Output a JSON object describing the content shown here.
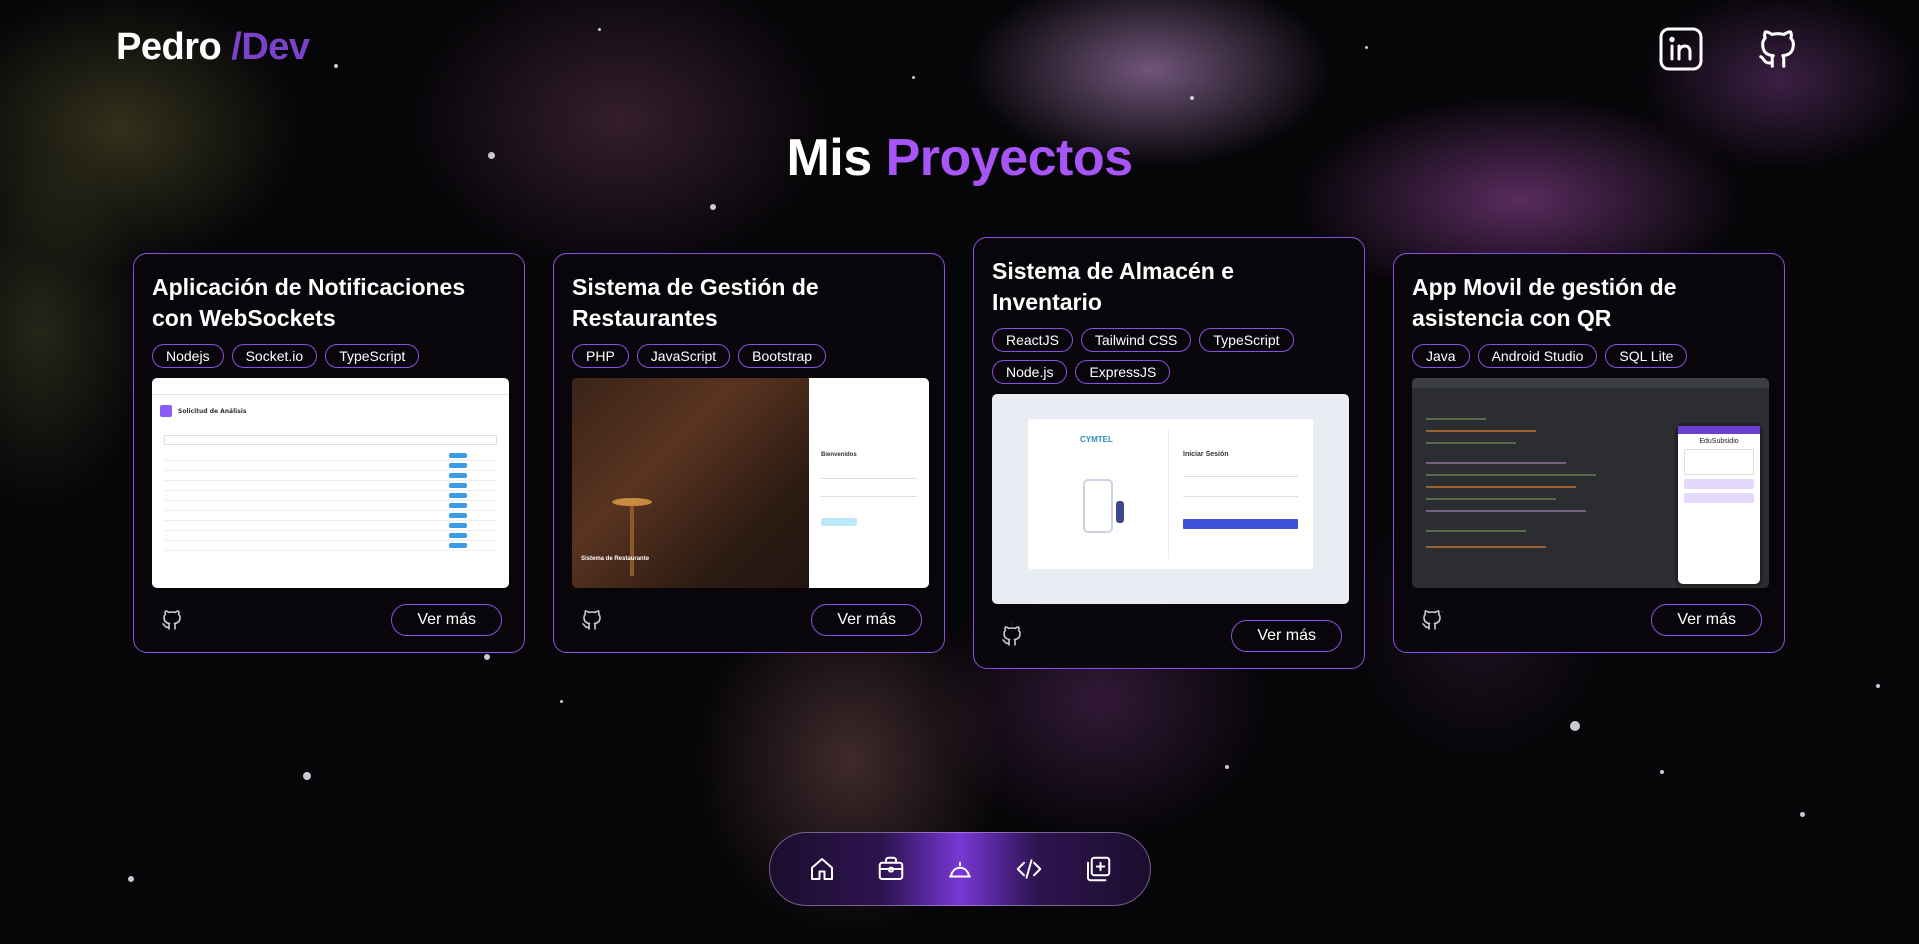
{
  "header": {
    "logo_name": "Pedro",
    "logo_accent": "/Dev",
    "social": [
      {
        "icon": "linkedin-icon"
      },
      {
        "icon": "github-icon"
      }
    ]
  },
  "page_title": {
    "prefix": "Mis",
    "accent": "Proyectos"
  },
  "colors": {
    "accent": "#a855f7",
    "card_border": "#8b4fe0",
    "background": "#060508"
  },
  "projects": [
    {
      "title": "Aplicación de Notificaciones con WebSockets",
      "tags": [
        "Nodejs",
        "Socket.io",
        "TypeScript"
      ],
      "screenshot": {
        "heading": "Solicitud de Análisis"
      },
      "github_icon": "github-icon",
      "button": "Ver más"
    },
    {
      "title": "Sistema de Gestión de Restaurantes",
      "tags": [
        "PHP",
        "JavaScript",
        "Bootstrap"
      ],
      "screenshot": {
        "caption": "Sistema de Restaurante",
        "welcome": "Bienvenidos"
      },
      "github_icon": "github-icon",
      "button": "Ver más"
    },
    {
      "title": "Sistema de Almacén e Inventario",
      "tags": [
        "ReactJS",
        "Tailwind CSS",
        "TypeScript",
        "Node.js",
        "ExpressJS"
      ],
      "screenshot": {
        "brand": "CYMTEL",
        "login_title": "Iniciar Sesión"
      },
      "github_icon": "github-icon",
      "button": "Ver más"
    },
    {
      "title": "App Movil de gestión de asistencia con QR",
      "tags": [
        "Java",
        "Android Studio",
        "SQL Lite"
      ],
      "screenshot": {
        "app_name": "EduSubsidio"
      },
      "github_icon": "github-icon",
      "button": "Ver más"
    }
  ],
  "dock": [
    {
      "icon": "home-icon"
    },
    {
      "icon": "briefcase-icon"
    },
    {
      "icon": "bell-icon",
      "active": true
    },
    {
      "icon": "code-icon"
    },
    {
      "icon": "add-square-icon"
    }
  ]
}
